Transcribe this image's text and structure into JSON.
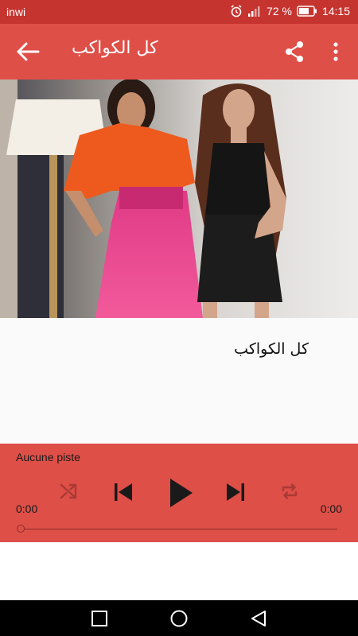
{
  "status_bar": {
    "carrier": "inwi",
    "battery_percent": "72 %",
    "time": "14:15",
    "icons": [
      "alarm-icon",
      "signal-icon",
      "battery-icon"
    ]
  },
  "toolbar": {
    "title": "كل الكواكب",
    "icons": [
      "back-arrow-icon",
      "share-icon",
      "more-vert-icon"
    ]
  },
  "content": {
    "track_title": "كل الكواكب"
  },
  "player": {
    "track_name": "Aucune piste",
    "elapsed": "0:00",
    "duration": "0:00",
    "progress": 0,
    "icons": [
      "shuffle-icon",
      "skip-previous-icon",
      "play-icon",
      "skip-next-icon",
      "repeat-icon"
    ]
  },
  "nav_bar": {
    "icons": [
      "recents-square-icon",
      "home-circle-icon",
      "back-triangle-icon"
    ]
  },
  "colors": {
    "status_bar": "#c6342f",
    "primary": "#de4f48",
    "player_dark": "#1a1a1a",
    "player_disabled": "#a83a35"
  }
}
